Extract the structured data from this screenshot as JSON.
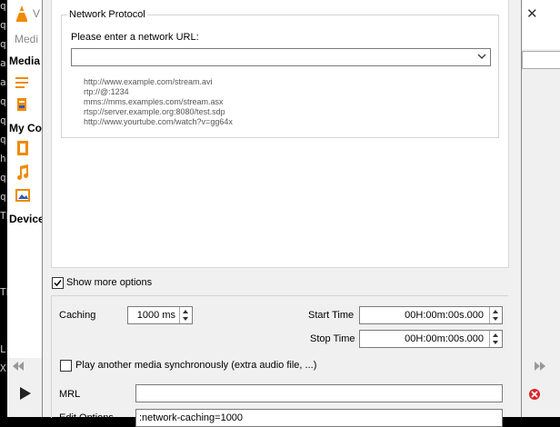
{
  "terminal": {
    "left_fragments": [
      "q",
      "q",
      "q",
      "a",
      "a",
      "q",
      "q",
      "q",
      "h",
      "q",
      "q",
      "Th",
      "",
      "",
      "",
      "Th",
      "",
      "",
      "Li",
      "X",
      "",
      ""
    ],
    "right_fragments": [
      "t",
      "t",
      "t",
      "t",
      "t",
      "t",
      "t",
      "t",
      "",
      "",
      "",
      "t",
      "t",
      "",
      "",
      "",
      "",
      "",
      "",
      "",
      "",
      ""
    ]
  },
  "vlc_main": {
    "title_initial": "V",
    "menu_fragment": "Medi",
    "sections": {
      "media_library": "Media",
      "my_computer": "My Co",
      "devices": "Device"
    }
  },
  "dialog": {
    "close_glyph": "✕",
    "group_title": "Network Protocol",
    "url_label": "Please enter a network URL:",
    "url_value": "",
    "examples": [
      "http://www.example.com/stream.avi",
      "rtp://@:1234",
      "mms://mms.examples.com/stream.asx",
      "rtsp://server.example.org:8080/test.sdp",
      "http://www.yourtube.com/watch?v=gg64x"
    ],
    "show_more_options": "Show more options",
    "show_more_checked": true,
    "caching_label": "Caching",
    "caching_value": "1000 ms",
    "start_time_label": "Start Time",
    "start_time_value": "00H:00m:00s.000",
    "stop_time_label": "Stop Time",
    "stop_time_value": "00H:00m:00s.000",
    "play_sync_label": "Play another media synchronously (extra audio file, ...)",
    "play_sync_checked": false,
    "mrl_label": "MRL",
    "mrl_value": "",
    "edit_options_label": "Edit Options",
    "edit_options_value": ":network-caching=1000"
  },
  "colors": {
    "vlc_orange": "#f08a00",
    "accent_red": "#d9252a"
  },
  "icons": [
    "vlc-cone-icon",
    "playlist-icon",
    "media-library-icon",
    "video-icon",
    "music-icon",
    "pictures-icon",
    "dropdown-arrow-icon",
    "play-icon",
    "rewind-icon",
    "fast-forward-icon",
    "close-icon",
    "error-icon"
  ]
}
